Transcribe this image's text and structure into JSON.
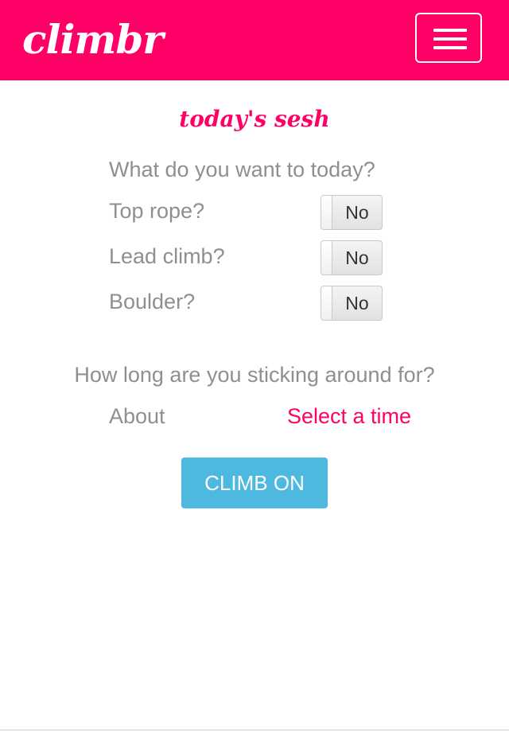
{
  "header": {
    "brand": "climbr",
    "menu_icon": "hamburger-menu-icon",
    "background_color": "#ff0066"
  },
  "session": {
    "title": "today's sesh",
    "question": "What do you want to today?",
    "options": [
      {
        "label": "Top rope?",
        "value": "No"
      },
      {
        "label": "Lead climb?",
        "value": "No"
      },
      {
        "label": "Boulder?",
        "value": "No"
      }
    ]
  },
  "duration": {
    "question": "How long are you sticking around for?",
    "prefix": "About",
    "select_label": "Select a time"
  },
  "submit": {
    "label": "CLIMB ON",
    "color": "#4db8e0"
  }
}
